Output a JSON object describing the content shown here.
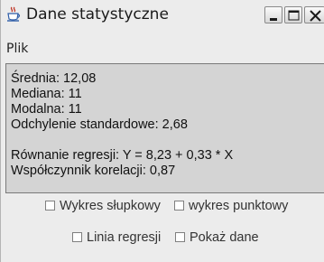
{
  "window": {
    "title": "Dane statystyczne",
    "controls": [
      "minimize",
      "maximize",
      "close"
    ]
  },
  "menu": {
    "file_label": "Plik"
  },
  "stats": {
    "mean": "Średnia: 12,08",
    "median": "Mediana: 11",
    "mode": "Modalna: 11",
    "stddev": "Odchylenie standardowe: 2,68",
    "regression": "Równanie regresji: Y = 8,23 + 0,33 * X",
    "correlation": "Współczynnik korelacji: 0,87"
  },
  "options": {
    "bar_chart": {
      "label": "Wykres słupkowy",
      "checked": false
    },
    "scatter_chart": {
      "label": "wykres punktowy",
      "checked": false
    },
    "regression_line": {
      "label": "Linia regresji",
      "checked": false
    },
    "show_data": {
      "label": "Pokaż dane",
      "checked": false
    }
  },
  "icons": {
    "app": "java-coffee-cup-icon"
  }
}
